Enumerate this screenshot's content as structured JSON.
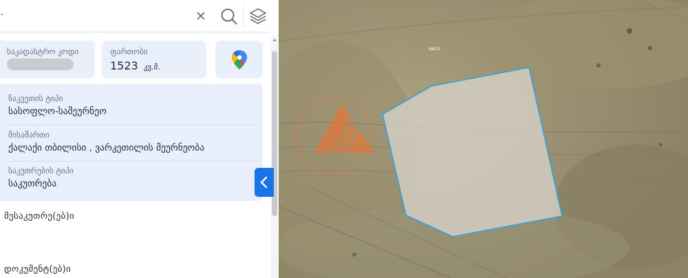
{
  "search": {
    "value": "·",
    "clear_icon": "close-icon",
    "search_icon": "search-icon",
    "layers_icon": "layers-icon"
  },
  "cadastral": {
    "code_label": "საკადასტრო კოდი",
    "code_value_hidden": true
  },
  "area": {
    "label": "ფართობი",
    "value": "1523",
    "unit": "კვ.მ."
  },
  "maps_button": {
    "icon": "google-maps-pin-icon"
  },
  "info": {
    "land_type_label": "ნაკვეთის ტიპი",
    "land_type_value": "სასოფლო-სამეურნეო",
    "address_label": "მისამართი",
    "address_value": "ქალაქი თბილისი , ვარკეთილის მეურნეობა",
    "ownership_label": "საკუთრების ტიპი",
    "ownership_value": "საკუთრება"
  },
  "sections": {
    "owners": "მესაკუთრე(ებ)ი",
    "documents": "დოკუმენტ(ებ)ი"
  },
  "toggle": {
    "icon": "chevron-left-icon"
  },
  "map": {
    "label": "NACS",
    "parcel_color": "#3aa0d8",
    "watermark_color": "#e0783a"
  },
  "colors": {
    "accent": "#1a73e8",
    "card_bg": "#eaf0fb"
  }
}
